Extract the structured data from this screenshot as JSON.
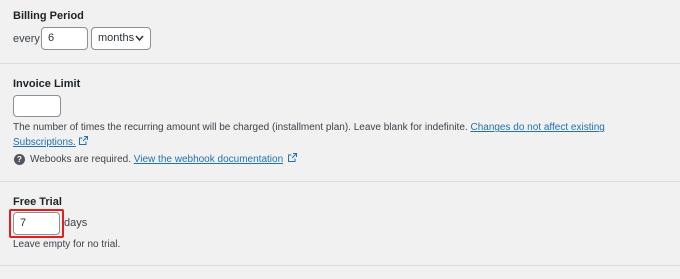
{
  "billing_period": {
    "label": "Billing Period",
    "every_text": "every",
    "interval_value": "6",
    "unit_selected": "months"
  },
  "invoice_limit": {
    "label": "Invoice Limit",
    "value": "",
    "description": "The number of times the recurring amount will be charged (installment plan). Leave blank for indefinite.",
    "link_line1": "Changes do not affect existing",
    "link_line2": "Subscriptions.",
    "webhook_text": "Webooks are required.",
    "webhook_link": "View the webhook documentation"
  },
  "free_trial": {
    "label": "Free Trial",
    "value": "7",
    "unit_text": "days",
    "hint": "Leave empty for no trial."
  },
  "colors": {
    "highlight": "#e02020",
    "link": "#2271b1"
  }
}
